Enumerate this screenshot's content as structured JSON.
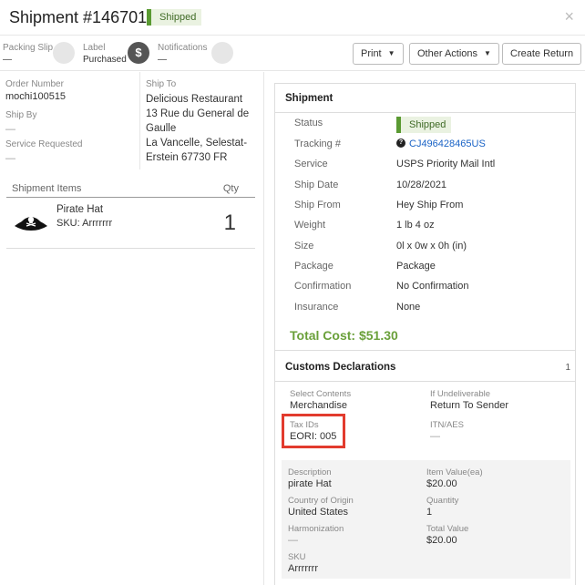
{
  "header": {
    "title": "Shipment #1467012",
    "status_badge": "Shipped",
    "close_icon": "×"
  },
  "toolbar": {
    "packing_slip": {
      "label": "Packing Slip",
      "value": "—"
    },
    "label": {
      "label": "Label",
      "value": "Purchased",
      "icon": "$"
    },
    "notifications": {
      "label": "Notifications",
      "value": "—"
    },
    "print_label": "Print",
    "other_actions_label": "Other Actions",
    "create_return_label": "Create Return",
    "caret": "▼"
  },
  "order": {
    "order_number_label": "Order Number",
    "order_number": "mochi100515",
    "ship_by_label": "Ship By",
    "ship_by": "—",
    "service_requested_label": "Service Requested",
    "service_requested": "—",
    "ship_to_label": "Ship To",
    "ship_to_lines": [
      "Delicious Restaurant",
      "13 Rue du General de",
      "Gaulle",
      "La Vancelle, Selestat-",
      "Erstein 67730 FR"
    ]
  },
  "items": {
    "header_items": "Shipment Items",
    "header_qty": "Qty",
    "rows": [
      {
        "name": "Pirate Hat",
        "sku": "SKU: Arrrrrrr",
        "qty": "1"
      }
    ]
  },
  "shipment": {
    "title": "Shipment",
    "rows": [
      {
        "label": "Status",
        "value": "Shipped",
        "kind": "badge"
      },
      {
        "label": "Tracking #",
        "value": "CJ496428465US",
        "kind": "link"
      },
      {
        "label": "Service",
        "value": "USPS Priority Mail Intl"
      },
      {
        "label": "Ship Date",
        "value": "10/28/2021"
      },
      {
        "label": "Ship From",
        "value": "Hey Ship From"
      },
      {
        "label": "Weight",
        "value": "1 lb 4 oz"
      },
      {
        "label": "Size",
        "value": "0l x 0w x 0h (in)"
      },
      {
        "label": "Package",
        "value": "Package"
      },
      {
        "label": "Confirmation",
        "value": "No Confirmation"
      },
      {
        "label": "Insurance",
        "value": "None"
      }
    ],
    "total_cost": "Total Cost: $51.30"
  },
  "customs": {
    "title": "Customs Declarations",
    "count": "1",
    "select_contents_label": "Select Contents",
    "select_contents": "Merchandise",
    "if_undeliverable_label": "If Undeliverable",
    "if_undeliverable": "Return To Sender",
    "tax_ids_label": "Tax IDs",
    "tax_ids": "EORI: 005",
    "itn_label": "ITN/AES",
    "itn": "—",
    "item": {
      "description_label": "Description",
      "description": "pirate Hat",
      "item_value_label": "Item Value(ea)",
      "item_value": "$20.00",
      "origin_label": "Country of Origin",
      "origin": "United States",
      "quantity_label": "Quantity",
      "quantity": "1",
      "harmonization_label": "Harmonization",
      "harmonization": "—",
      "total_value_label": "Total Value",
      "total_value": "$20.00",
      "sku_label": "SKU",
      "sku": "Arrrrrrr"
    }
  },
  "colors": {
    "accent_green": "#6aa03a",
    "badge_green": "#5a9a32",
    "link_blue": "#1a63c6",
    "highlight_red": "#e23b2e"
  }
}
